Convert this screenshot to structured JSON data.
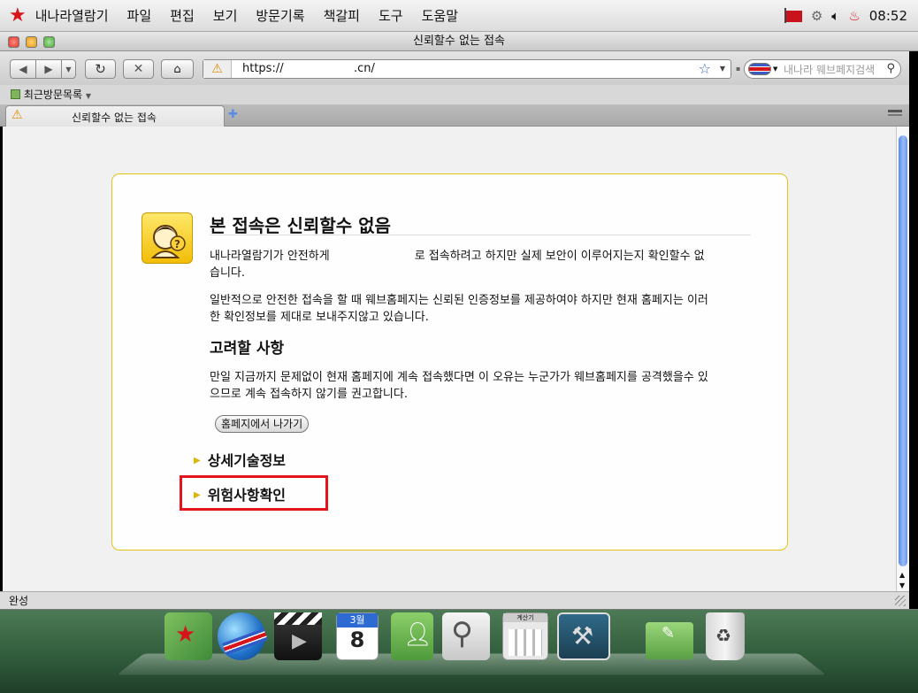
{
  "menubar": {
    "items": [
      "내나라열람기",
      "파일",
      "편집",
      "보기",
      "방문기록",
      "책갈피",
      "도구",
      "도움말"
    ],
    "clock": "08:52"
  },
  "window": {
    "title": "신뢰할수 없는 접속"
  },
  "nav": {
    "url_prefix": "https://",
    "url_suffix": ".cn/",
    "search_placeholder": "내나라 웨브페지검색"
  },
  "bookmarks": {
    "recent_label": "최근방문목록"
  },
  "tab": {
    "title": "신뢰할수 없는 접속"
  },
  "error": {
    "title": "본 접속은 신뢰할수 없음",
    "intro_part1": "내나라열람기가 안전하게",
    "intro_part2": "로 접속하려고 하지만 실제 보안이 이루어지는지 확인할수 없",
    "intro_line2": "습니다.",
    "para2_line1": "일반적으로 안전한 접속을 할 때 웨브홈페지는 신뢰된 인증정보를 제공하여야 하지만 현재 홈페지는 이러",
    "para2_line2": "한 확인정보를 제대로 보내주지않고 있습니다.",
    "consider_heading": "고려할 사항",
    "consider_line1": "만일 지금까지 문제없이 현재 홈페지에 계속 접속했다면 이 오유는 누군가가 웨브홈페지를 공격했을수 있",
    "consider_line2": "으므로 계속 접속하지 않기를 권고합니다.",
    "exit_button": "홈페지에서 나가기",
    "technical_details": "상세기술정보",
    "risk_confirm": "위험사항확인"
  },
  "status": {
    "text": "완성"
  },
  "dock": {
    "calendar_month": "3월",
    "calendar_day": "8",
    "calc_title": "계산기"
  },
  "colors": {
    "accent_red": "#e3141b",
    "card_border": "#e3c21b",
    "scroll_blue": "#5b8be5"
  }
}
